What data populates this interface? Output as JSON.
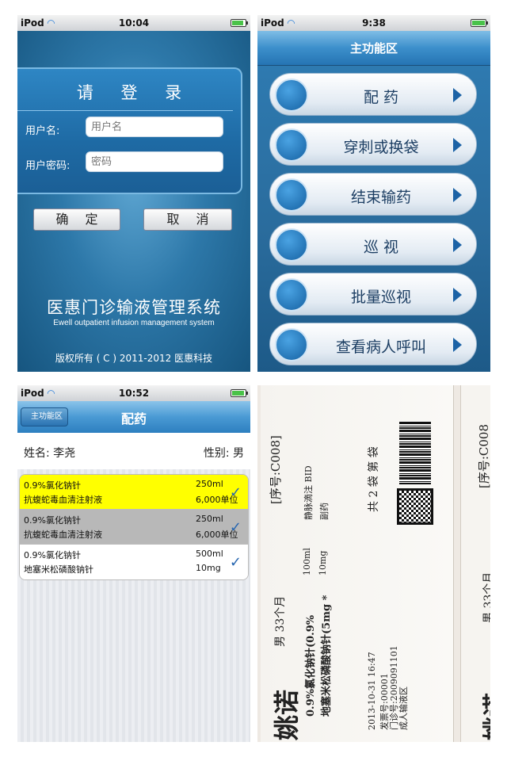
{
  "login": {
    "status": {
      "carrier": "iPod",
      "time": "10:04",
      "battery_level": 0.85
    },
    "title": "请 登 录",
    "username_label": "用户名:",
    "username_placeholder": "用户名",
    "password_label": "用户密码:",
    "password_placeholder": "密码",
    "confirm_label": "确 定",
    "cancel_label": "取 消",
    "system_name": "医惠门诊输液管理系统",
    "system_name_en": "Ewell outpatient infusion management system",
    "copyright": "版权所有 ( C ) 2011-2012 医惠科技"
  },
  "menu": {
    "status": {
      "carrier": "iPod",
      "time": "9:38",
      "battery_level": 1.0
    },
    "title": "主功能区",
    "items": [
      {
        "label": "配  药",
        "icon": "bottle-icon"
      },
      {
        "label": "穿刺或换袋",
        "icon": "drops-icon"
      },
      {
        "label": "结束输药",
        "icon": "end-infusion-icon"
      },
      {
        "label": "巡  视",
        "icon": "eye-icon"
      },
      {
        "label": "批量巡视",
        "icon": "eye-icon"
      },
      {
        "label": "查看病人呼叫",
        "icon": "call-icon"
      }
    ]
  },
  "dose": {
    "status": {
      "carrier": "iPod",
      "time": "10:52",
      "battery_level": 0.9
    },
    "back_label": "主功能区",
    "title": "配药",
    "patient_name": "姓名: 李尧",
    "patient_sex": "性别: 男",
    "rows": [
      {
        "drug1": "0.9%氯化钠针",
        "drug2": "抗蝮蛇毒血清注射液",
        "vol1": "250ml",
        "vol2": "6,000单位",
        "bg": "#ffff00",
        "checked": "✓"
      },
      {
        "drug1": "0.9%氯化钠针",
        "drug2": "抗蝮蛇毒血清注射液",
        "vol1": "250ml",
        "vol2": "6,000单位",
        "bg": "#b8b8b8",
        "checked": "✓"
      },
      {
        "drug1": "0.9%氯化钠针",
        "drug2": "地塞米松磷酸钠针",
        "vol1": "500ml",
        "vol2": "10mg",
        "bg": "#ffffff",
        "checked": "✓"
      }
    ]
  },
  "photo": {
    "name": "姚诺",
    "sex_age": "男 33个月",
    "seq": "[序号:C008]",
    "line1": "0.9%氯化钠针(0.9%",
    "line1_vol": "100ml",
    "line1_route": "静脉滴注 BID",
    "line2": "地塞米松磷酸钠针(5mg *",
    "line2_dose": "10mg",
    "line2_note": "副药",
    "bags": "共 2 袋 第   袋",
    "datetime": "2013-10-31 16:47",
    "invoice": "发票号:00001",
    "clinic": "门诊号:2009091101",
    "area": "成人输液区",
    "name2": "姚诺",
    "sex_age2": "男 33个月",
    "seq2": "[序号:C008"
  }
}
